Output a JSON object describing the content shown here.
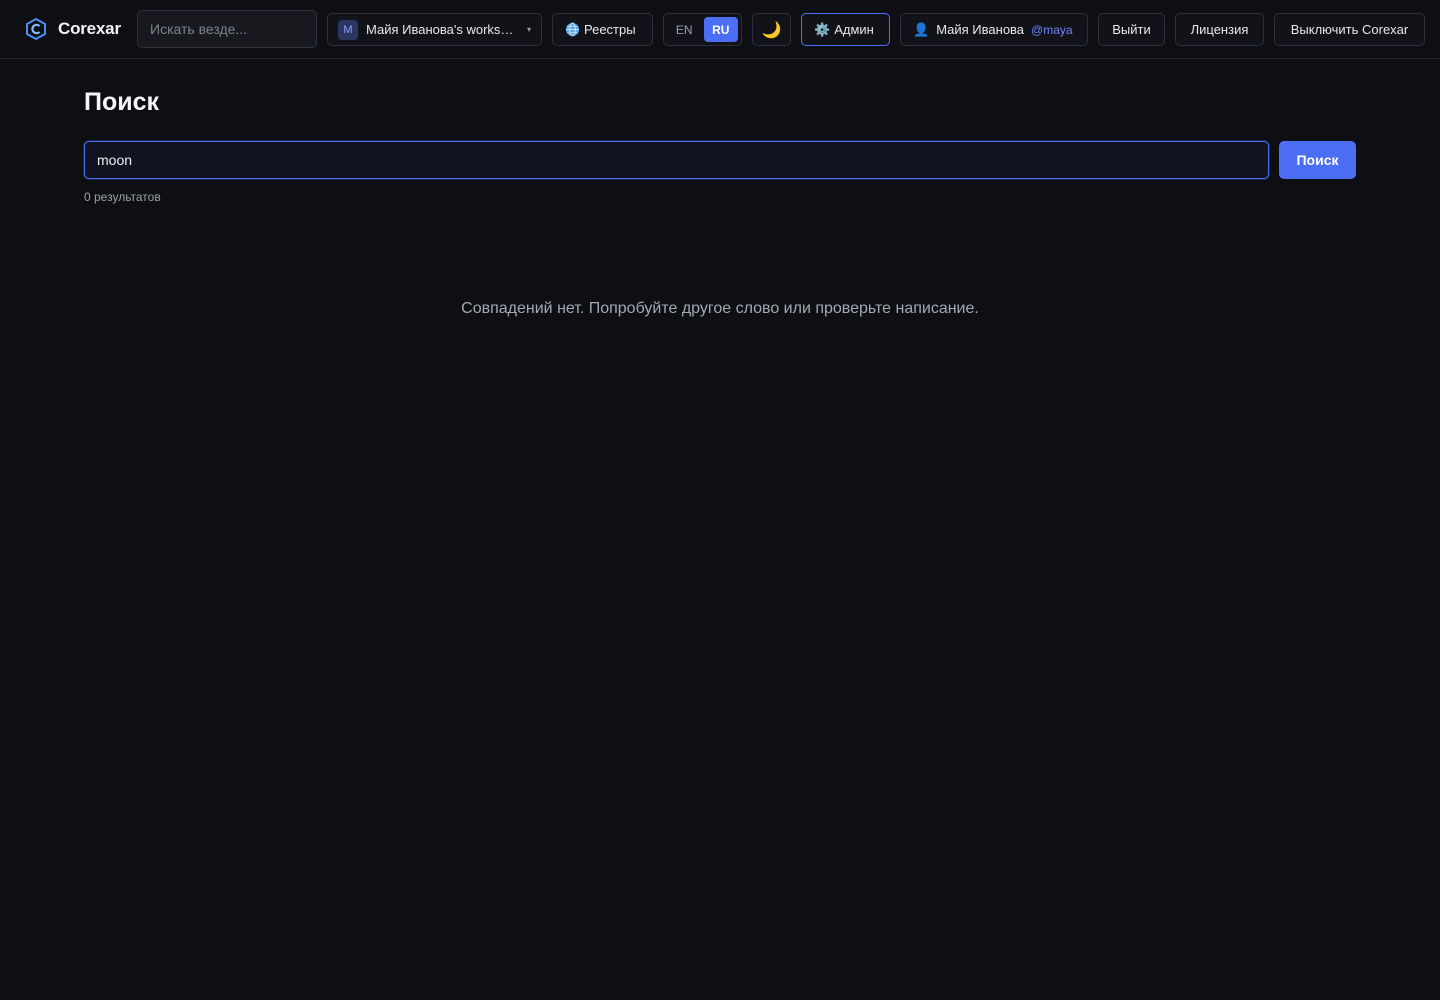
{
  "app": {
    "brand": "Corexar",
    "global_search_placeholder": "Искать везде..."
  },
  "header": {
    "workspace": {
      "initial": "M",
      "name": "Майя Иванова's workspace"
    },
    "registries_label": "Реестры",
    "languages": [
      {
        "code": "EN",
        "active": false
      },
      {
        "code": "RU",
        "active": true
      }
    ],
    "theme_icon": "moon-icon",
    "admin_label": "Админ",
    "user": {
      "name": "Майя Иванова",
      "handle": "@maya"
    },
    "logout_label": "Выйти",
    "license_label": "Лицензия",
    "shutdown_label": "Выключить Corexar"
  },
  "main": {
    "title": "Поиск",
    "search_value": "moon",
    "search_button_label": "Поиск",
    "results_count": "0 результатов",
    "empty_message": "Совпадений нет. Попробуйте другое слово или проверьте написание."
  },
  "colors": {
    "background": "#0e0f13",
    "accent": "#4c6ef5",
    "muted_text": "#9aa0ab"
  }
}
